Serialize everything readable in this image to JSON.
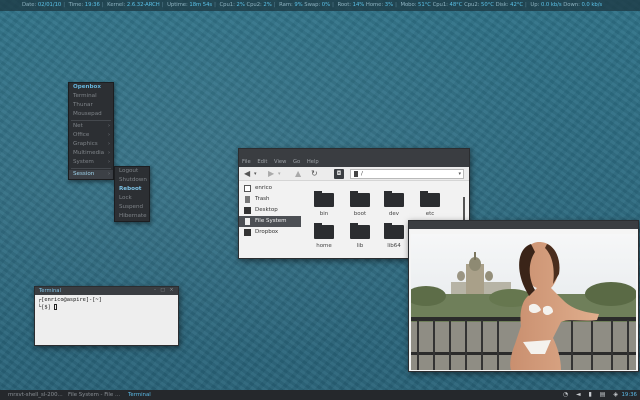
{
  "statusbar": {
    "segments": [
      {
        "label": "Date:",
        "value": "02/01/10"
      },
      {
        "label": "Time:",
        "value": "19:36"
      },
      {
        "label": "Kernel:",
        "value": "2.6.32-ARCH"
      },
      {
        "label": "Uptime:",
        "value": "18m 54s"
      },
      {
        "label": "Cpu1:",
        "value": "2%"
      },
      {
        "label": "Cpu2:",
        "value": "2%"
      },
      {
        "label": "Ram:",
        "value": "9%"
      },
      {
        "label": "Swap:",
        "value": "0%"
      },
      {
        "label": "Root:",
        "value": "14%"
      },
      {
        "label": "Home:",
        "value": "3%"
      },
      {
        "label": "Mobo:",
        "value": "51°C"
      },
      {
        "label": "Cpu1:",
        "value": "48°C"
      },
      {
        "label": "Cpu2:",
        "value": "50°C"
      },
      {
        "label": "Disk:",
        "value": "42°C"
      },
      {
        "label": "Up:",
        "value": "0.0 kb/s"
      },
      {
        "label": "Down:",
        "value": "0.0 kb/s"
      }
    ]
  },
  "menu": {
    "title": "Openbox",
    "items": [
      {
        "label": "Terminal"
      },
      {
        "label": "Thunar"
      },
      {
        "label": "Mousepad"
      }
    ],
    "submenus": [
      {
        "label": "Net",
        "arrow": "›"
      },
      {
        "label": "Office",
        "arrow": "›"
      },
      {
        "label": "Graphics",
        "arrow": "›"
      },
      {
        "label": "Multimedia",
        "arrow": "›"
      },
      {
        "label": "System",
        "arrow": "›"
      }
    ],
    "session": {
      "label": "Session",
      "arrow": "›"
    }
  },
  "session_menu": {
    "items": [
      "Logout",
      "Shutdown",
      "Reboot",
      "Lock",
      "Suspend",
      "Hibernate"
    ],
    "highlighted": "Reboot"
  },
  "file_manager": {
    "menu": [
      "File",
      "Edit",
      "View",
      "Go",
      "Help"
    ],
    "location": "/",
    "sidebar": [
      {
        "label": "enrico",
        "icon": "home-icon"
      },
      {
        "label": "Trash",
        "icon": "trash-icon"
      },
      {
        "label": "Desktop",
        "icon": "desktop-icon"
      },
      {
        "label": "File System",
        "icon": "drive-icon",
        "selected": true
      },
      {
        "label": "Dropbox",
        "icon": "dropbox-icon"
      }
    ],
    "folders": [
      "bin",
      "boot",
      "dev",
      "etc",
      "home",
      "lib",
      "lib64"
    ]
  },
  "terminal": {
    "title": "Terminal",
    "line1": "┌[enrico@aspire]-[~]",
    "line2": "└[$] "
  },
  "taskbar": {
    "tasks": [
      "mrxvt-shell_sl-200...",
      "File System - File ...",
      "Terminal"
    ],
    "active": "Terminal",
    "clock": "19:36"
  }
}
